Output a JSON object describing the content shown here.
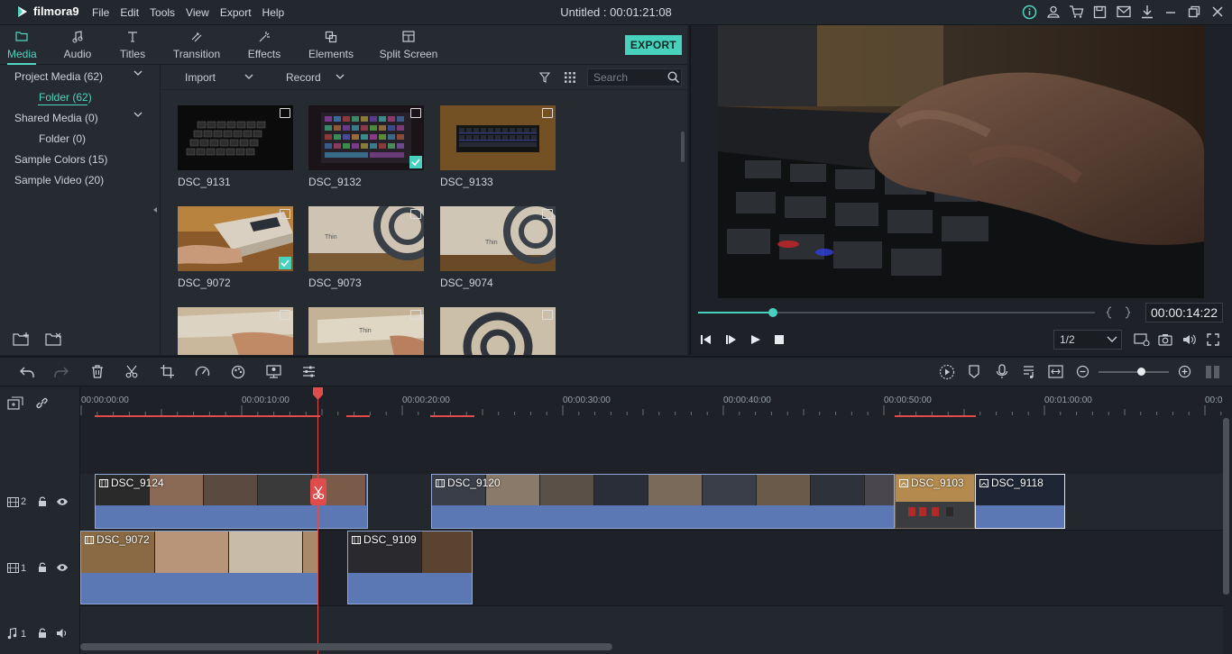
{
  "app": {
    "name": "filmora9",
    "title": "Untitled : 00:01:21:08",
    "menu": [
      "File",
      "Edit",
      "Tools",
      "View",
      "Export",
      "Help"
    ]
  },
  "colors": {
    "accent": "#48d1bd",
    "playhead": "#e04b4b",
    "clip": "#5a76b2"
  },
  "tabs": [
    {
      "label": "Media",
      "icon": "folder-icon",
      "active": true
    },
    {
      "label": "Audio",
      "icon": "music-note-icon"
    },
    {
      "label": "Titles",
      "icon": "titles-icon"
    },
    {
      "label": "Transition",
      "icon": "transition-icon"
    },
    {
      "label": "Effects",
      "icon": "effects-icon"
    },
    {
      "label": "Elements",
      "icon": "elements-icon"
    },
    {
      "label": "Split Screen",
      "icon": "split-screen-icon"
    }
  ],
  "export_label": "EXPORT",
  "sidebar": {
    "items": [
      {
        "label": "Project Media (62)"
      },
      {
        "label": "Folder (62)",
        "active": true
      },
      {
        "label": "Shared Media (0)"
      },
      {
        "label": "Folder (0)"
      },
      {
        "label": "Sample Colors (15)"
      },
      {
        "label": "Sample Video (20)"
      }
    ]
  },
  "media_toolbar": {
    "import": "Import",
    "record": "Record",
    "search_placeholder": "Search"
  },
  "media": [
    {
      "name": "DSC_9131",
      "type": "image",
      "checked": false
    },
    {
      "name": "DSC_9132",
      "type": "image",
      "checked": true
    },
    {
      "name": "DSC_9133",
      "type": "image",
      "checked": false
    },
    {
      "name": "DSC_9072",
      "type": "video",
      "checked": true
    },
    {
      "name": "DSC_9073",
      "type": "video",
      "checked": false
    },
    {
      "name": "DSC_9074",
      "type": "video",
      "checked": false
    },
    {
      "name": "",
      "type": "video",
      "checked": false
    },
    {
      "name": "",
      "type": "video",
      "checked": false
    },
    {
      "name": "",
      "type": "video",
      "checked": false
    }
  ],
  "preview": {
    "timecode": "00:00:14:22",
    "ratio": "1/2",
    "progress": 0.19
  },
  "ruler": [
    "00:00:00:00",
    "00:00:10:00",
    "00:00:20:00",
    "00:00:30:00",
    "00:00:40:00",
    "00:00:50:00",
    "00:01:00:00",
    "00:0"
  ],
  "tracks": {
    "video2": {
      "label": "2"
    },
    "video1": {
      "label": "1"
    },
    "audio1": {
      "label": "1"
    }
  },
  "clips": {
    "track2": [
      "DSC_9124",
      "DSC_9120",
      "DSC_9103",
      "DSC_9118"
    ],
    "track1": [
      "DSC_9072",
      "DSC_9109"
    ]
  }
}
